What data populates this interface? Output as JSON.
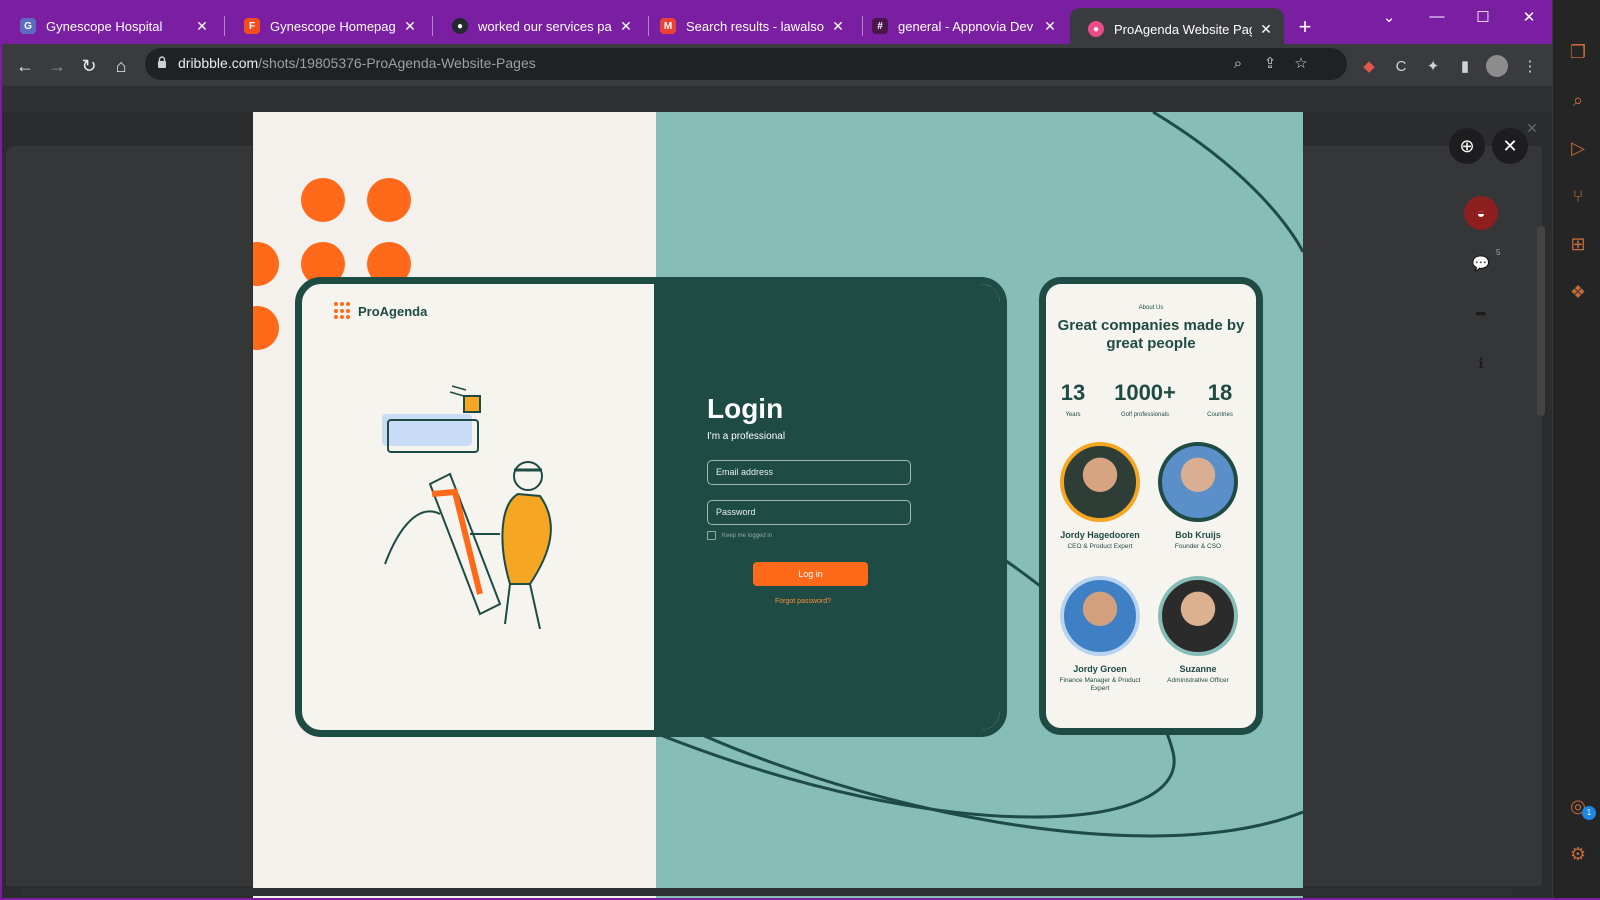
{
  "browser": {
    "tabs": [
      {
        "label": "Gynescope Hospital",
        "icon": "figma-blue-icon",
        "color": "#5c6bc0"
      },
      {
        "label": "Gynescope Homepage – Fig",
        "icon": "figma-icon",
        "color": "#f24e1e"
      },
      {
        "label": "worked our services page by",
        "icon": "github-icon",
        "color": "#24292e"
      },
      {
        "label": "Search results - lawalsonolu",
        "icon": "gmail-icon",
        "color": "#ea4335"
      },
      {
        "label": "general - Appnovia Dev - Sl",
        "icon": "slack-icon",
        "color": "#4a154b"
      },
      {
        "label": "ProAgenda Website Pages b",
        "icon": "dribbble-icon",
        "color": "#ea4c89",
        "active": true
      }
    ],
    "new_tab": "+",
    "window_controls": {
      "dropdown": "⌄",
      "minimize": "—",
      "maximize": "☐",
      "close": "✕"
    },
    "url_host": "dribbble.com",
    "url_path": "/shots/19805376-ProAgenda-Website-Pages"
  },
  "shot": {
    "logo": "ProAgenda",
    "login": {
      "title": "Login",
      "subtitle": "I'm a professional",
      "email_placeholder": "Email address",
      "password_placeholder": "Password",
      "remember": "Keep me logged in",
      "button": "Log in",
      "forgot": "Forgot password?"
    },
    "about": {
      "eyebrow": "About Us",
      "title": "Great companies made by great people",
      "stats": [
        {
          "value": "13",
          "label": "Years"
        },
        {
          "value": "1000+",
          "label": "Golf professionals"
        },
        {
          "value": "18",
          "label": "Countries"
        }
      ],
      "people": [
        {
          "name": "Jordy Hagedooren",
          "role": "CEO & Product Expert",
          "ring": "#f5a623"
        },
        {
          "name": "Bob Kruijs",
          "role": "Founder & CSO",
          "ring": "#1f4b45"
        },
        {
          "name": "Jordy Groen",
          "role": "Finance Manager & Product Expert",
          "ring": "#b9d3f0"
        },
        {
          "name": "Suzanne",
          "role": "Administrative Officer",
          "ring": "#86bdb7"
        }
      ]
    },
    "colors": {
      "orange": "#ff6a1a",
      "teal_dark": "#1f4b45",
      "teal_light": "#86bdb7",
      "cream": "#f4f1ec"
    }
  },
  "modal": {
    "zoom_icon": "zoom-in-icon",
    "close_icon": "close-icon",
    "comment_count": "5"
  }
}
